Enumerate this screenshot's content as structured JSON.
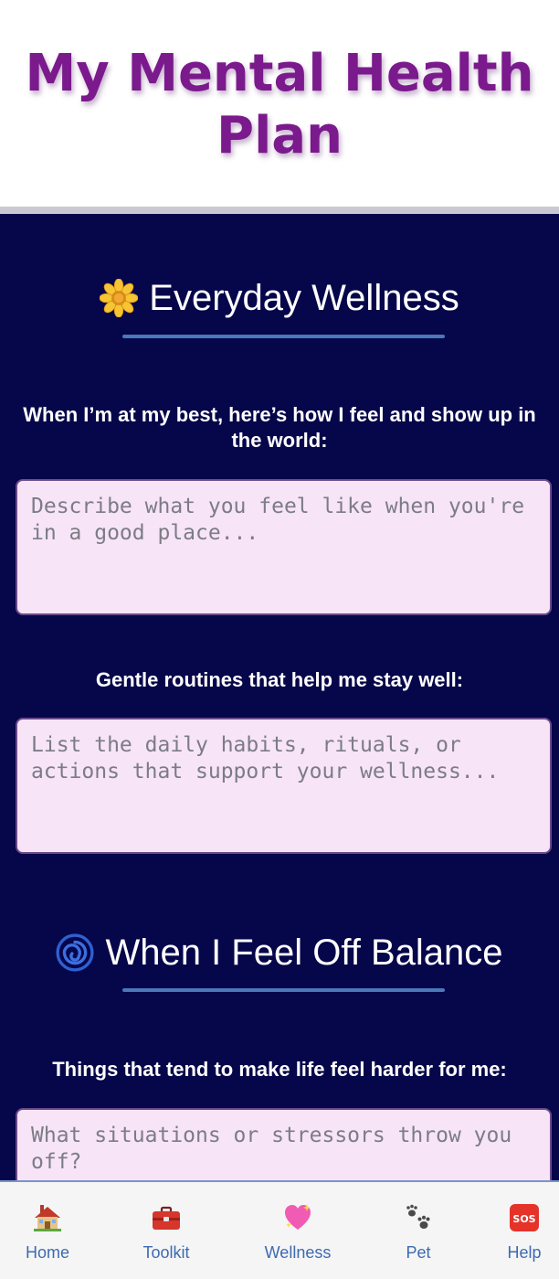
{
  "header": {
    "title": "My Mental Health Plan"
  },
  "sections": [
    {
      "icon": "sunflower-icon",
      "title": "Everyday Wellness",
      "fields": [
        {
          "label": "When I’m at my best, here’s how I feel and show up in the world:",
          "placeholder": "Describe what you feel like when you're in a good place...",
          "value": ""
        },
        {
          "label": "Gentle routines that help me stay well:",
          "placeholder": "List the daily habits, rituals, or actions that support your wellness...",
          "value": ""
        }
      ]
    },
    {
      "icon": "cyclone-icon",
      "title": "When I Feel Off Balance",
      "fields": [
        {
          "label": "Things that tend to make life feel harder for me:",
          "placeholder": "What situations or stressors throw you off?",
          "value": ""
        }
      ]
    }
  ],
  "nav": {
    "items": [
      {
        "label": "Home",
        "icon": "house-icon"
      },
      {
        "label": "Toolkit",
        "icon": "toolbox-icon"
      },
      {
        "label": "Wellness",
        "icon": "sparkling-heart-icon"
      },
      {
        "label": "Pet",
        "icon": "paw-prints-icon"
      },
      {
        "label": "Help",
        "icon": "sos-icon"
      }
    ]
  },
  "colors": {
    "title": "#7a1a8c",
    "background": "#06064a",
    "accent_rule": "#4a78b8",
    "field_bg": "#f7e4f7",
    "nav_text": "#3d6ab0"
  }
}
